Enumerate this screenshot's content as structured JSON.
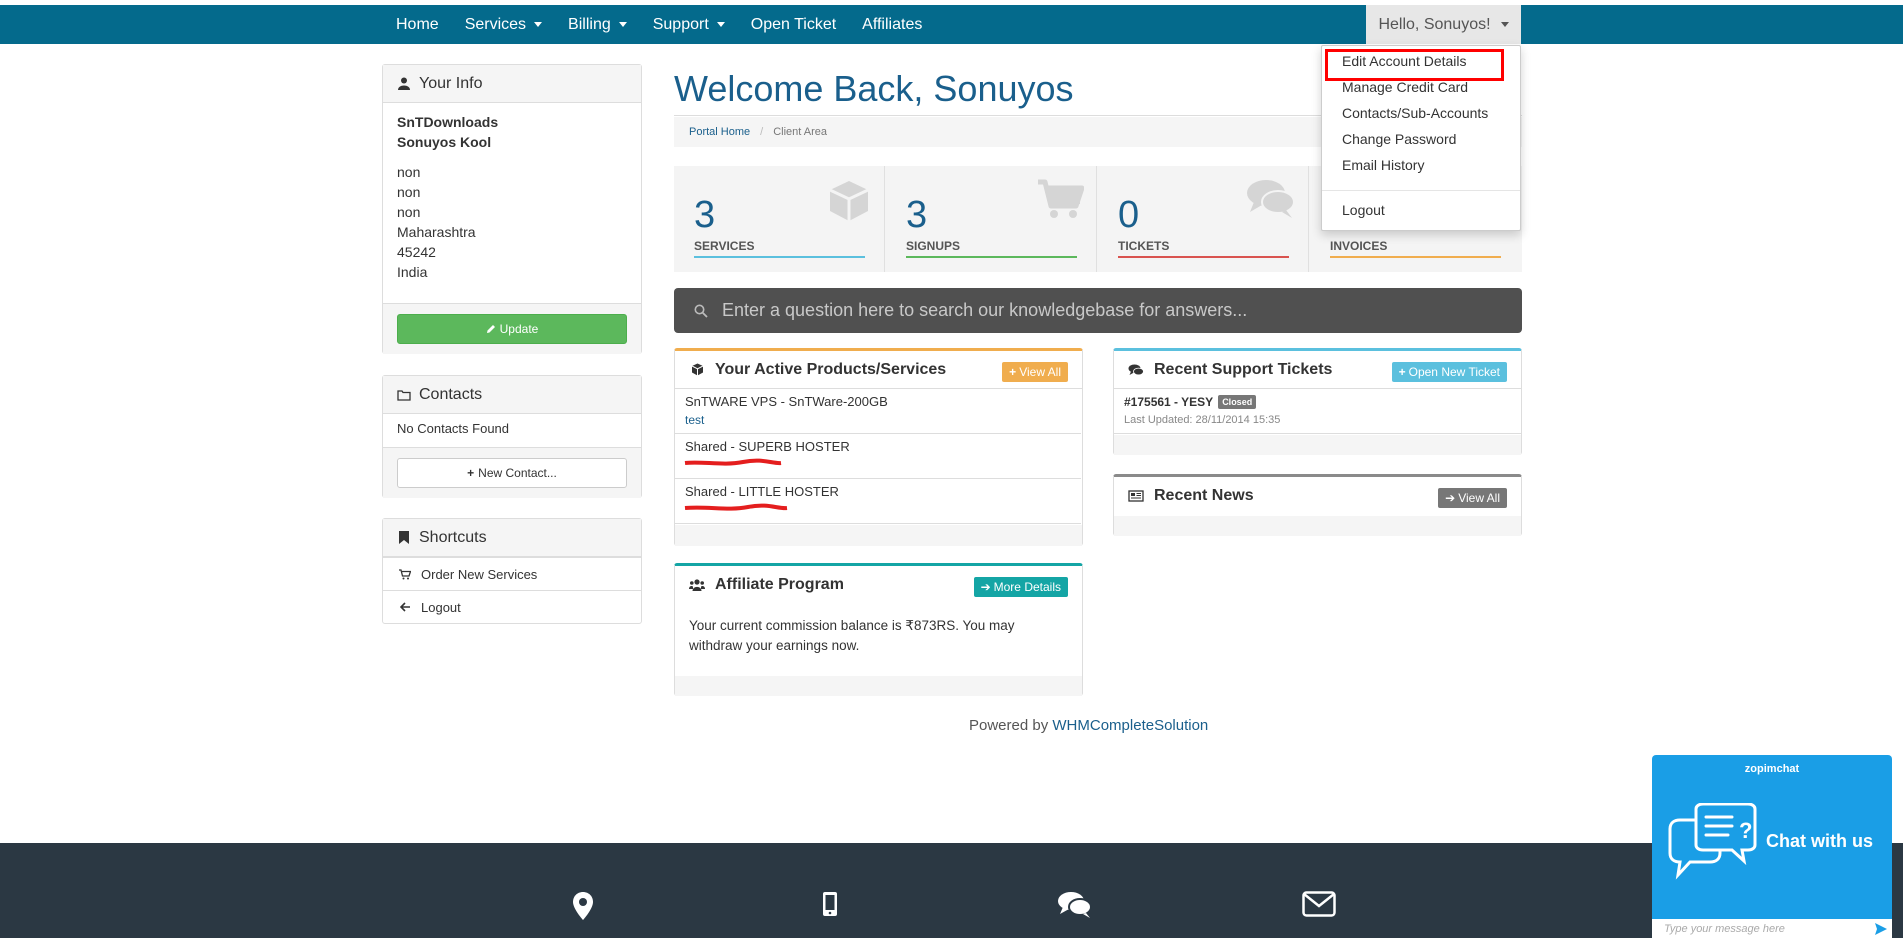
{
  "nav": {
    "items": [
      {
        "label": "Home",
        "caret": false
      },
      {
        "label": "Services",
        "caret": true
      },
      {
        "label": "Billing",
        "caret": true
      },
      {
        "label": "Support",
        "caret": true
      },
      {
        "label": "Open Ticket",
        "caret": false
      },
      {
        "label": "Affiliates",
        "caret": false
      }
    ],
    "user_label": "Hello, Sonuyos!"
  },
  "dropdown": {
    "items": [
      "Edit Account Details",
      "Manage Credit Card",
      "Contacts/Sub-Accounts",
      "Change Password",
      "Email History"
    ],
    "logout": "Logout"
  },
  "your_info": {
    "title": "Your Info",
    "company": "SnTDownloads",
    "name": "Sonuyos Kool",
    "address": [
      "non",
      "non",
      "non",
      "Maharashtra",
      "45242",
      "India"
    ],
    "update_button": "Update"
  },
  "contacts": {
    "title": "Contacts",
    "empty": "No Contacts Found",
    "new_button": "New Contact..."
  },
  "shortcuts": {
    "title": "Shortcuts",
    "items": [
      {
        "label": "Order New Services",
        "icon": "cart-icon"
      },
      {
        "label": "Logout",
        "icon": "arrow-left-icon"
      }
    ]
  },
  "main": {
    "welcome": "Welcome Back, Sonuyos",
    "breadcrumb": {
      "home": "Portal Home",
      "current": "Client Area"
    },
    "stats": [
      {
        "value": "3",
        "label": "SERVICES",
        "color": "#5bc0de",
        "icon": "cube-icon"
      },
      {
        "value": "3",
        "label": "SIGNUPS",
        "color": "#5cb85c",
        "icon": "cart-icon"
      },
      {
        "value": "0",
        "label": "TICKETS",
        "color": "#d9534f",
        "icon": "comments-icon"
      },
      {
        "value": "",
        "label": "INVOICES",
        "color": "#f0ad4e",
        "icon": "invoice-icon"
      }
    ],
    "kb_placeholder": "Enter a question here to search our knowledgebase for answers..."
  },
  "products": {
    "title": "Your Active Products/Services",
    "view_all": "View All",
    "rows": [
      {
        "name": "SnTWARE VPS - SnTWare-200GB",
        "sub": "test"
      },
      {
        "name": "Shared - SUPERB HOSTER",
        "sub": ""
      },
      {
        "name": "Shared - LITTLE HOSTER",
        "sub": ""
      }
    ]
  },
  "tickets": {
    "title": "Recent Support Tickets",
    "open_new": "Open New Ticket",
    "row": {
      "title": "#175561 - YESY",
      "status": "Closed",
      "updated": "Last Updated: 28/11/2014 15:35"
    }
  },
  "news": {
    "title": "Recent News",
    "view_all": "View All"
  },
  "affiliate": {
    "title": "Affiliate Program",
    "more": "More Details",
    "text": "Your current commission balance is ₹873RS. You may withdraw your earnings now."
  },
  "powered": {
    "prefix": "Powered by",
    "link": "WHMCompleteSolution"
  },
  "zopim": {
    "logo": "zopimchat",
    "message": "Chat with us",
    "input_placeholder": "Type your message here"
  },
  "colors": {
    "navbar": "#046a8c",
    "accent": "#1a5f8c",
    "footer": "#2b3843",
    "zopim": "#1a9ee6"
  }
}
